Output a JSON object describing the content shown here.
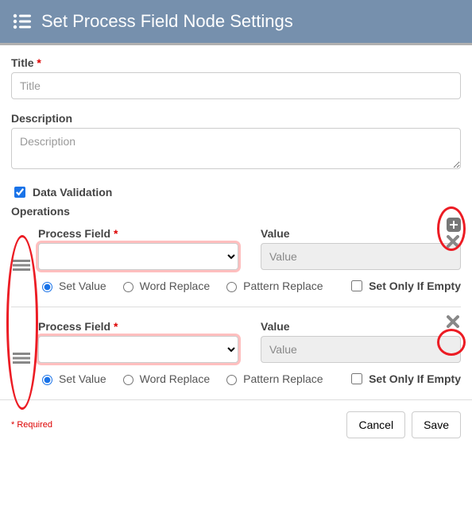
{
  "header": {
    "title": "Set Process Field Node Settings"
  },
  "fields": {
    "title_label": "Title",
    "title_placeholder": "Title",
    "description_label": "Description",
    "description_placeholder": "Description",
    "data_validation_label": "Data Validation",
    "data_validation_checked": true,
    "operations_label": "Operations"
  },
  "operation_labels": {
    "process_field": "Process Field",
    "value": "Value",
    "value_placeholder": "Value",
    "set_value": "Set Value",
    "word_replace": "Word Replace",
    "pattern_replace": "Pattern Replace",
    "set_only_if_empty": "Set Only If Empty"
  },
  "operations": [
    {
      "process_field": "",
      "value": "",
      "mode": "set_value",
      "set_only_if_empty": false
    },
    {
      "process_field": "",
      "value": "",
      "mode": "set_value",
      "set_only_if_empty": false
    }
  ],
  "footer": {
    "required_note": "* Required",
    "cancel": "Cancel",
    "save": "Save"
  }
}
